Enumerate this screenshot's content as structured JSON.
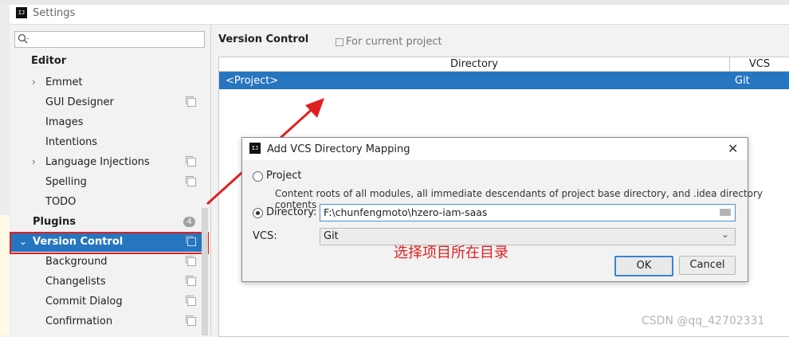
{
  "window": {
    "title": "Settings",
    "app_icon": "intellij-logo-icon"
  },
  "sidebar": {
    "search_placeholder": "",
    "items": [
      {
        "label": "Editor",
        "bold": true
      },
      {
        "label": "Emmet",
        "expandable": true
      },
      {
        "label": "GUI Designer"
      },
      {
        "label": "Images"
      },
      {
        "label": "Intentions"
      },
      {
        "label": "Language Injections",
        "expandable": true
      },
      {
        "label": "Spelling"
      },
      {
        "label": "TODO"
      },
      {
        "label": "Plugins",
        "bold": true,
        "badge": "4"
      },
      {
        "label": "Version Control",
        "bold": true,
        "selected": true,
        "expanded": true
      },
      {
        "label": "Background"
      },
      {
        "label": "Changelists"
      },
      {
        "label": "Commit Dialog"
      },
      {
        "label": "Confirmation"
      }
    ]
  },
  "panel": {
    "title": "Version Control",
    "scope": "For current project",
    "table": {
      "headers": [
        "Directory",
        "VCS"
      ],
      "rows": [
        {
          "directory": "<Project>",
          "vcs": "Git"
        }
      ]
    }
  },
  "dialog": {
    "title": "Add VCS Directory Mapping",
    "project_option": "Project",
    "project_desc": "Content roots of all modules, all immediate descendants of project base directory, and .idea directory contents",
    "directory_option": "Directory:",
    "directory_value": "F:\\chunfengmoto\\hzero-iam-saas",
    "vcs_label": "VCS:",
    "vcs_value": "Git",
    "ok": "OK",
    "cancel": "Cancel",
    "selected_option": "directory"
  },
  "annotation": {
    "text": "选择项目所在目录",
    "color": "#e02020"
  },
  "watermark": "CSDN @qq_42702331",
  "colors": {
    "selection": "#2675bf",
    "highlight": "#e02020"
  }
}
